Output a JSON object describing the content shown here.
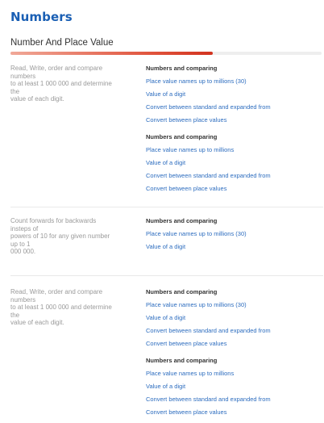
{
  "page": {
    "title": "Numbers",
    "subheading": "Number And Place Value",
    "progress": 0.65
  },
  "sections": [
    {
      "description": "Read, Write, order and compare\nnumbers\nto at least 1 000 000 and determine\nthe\nvalue of each digit.",
      "groups": [
        {
          "title": "Numbers and comparing",
          "links": [
            "Place value names up to millions (30)",
            "Value of a digit",
            "Convert between standard and expanded from",
            "Convert between place values"
          ]
        },
        {
          "title": "Numbers and comparing",
          "links": [
            "Place value names up to millions",
            "Value of a digit",
            "Convert between standard and expanded from",
            "Convert between place values"
          ]
        }
      ]
    },
    {
      "description": "Count forwards for backwards\ninsteps of\npowers of 10 for any given number\nup to 1\n000 000.",
      "groups": [
        {
          "title": "Numbers and comparing",
          "links": [
            "Place value names up to millions (30)",
            "Value of a digit"
          ]
        }
      ]
    },
    {
      "description": "Read, Write, order and compare\nnumbers\nto at least 1 000 000 and determine\nthe\nvalue of each digit.",
      "groups": [
        {
          "title": "Numbers and comparing",
          "links": [
            "Place value names up to millions (30)",
            "Value of a digit",
            "Convert between standard and expanded from",
            "Convert between place values"
          ]
        },
        {
          "title": "Numbers and comparing",
          "links": [
            "Place value names up to millions",
            "Value of a digit",
            "Convert between standard and expanded from",
            "Convert between place values"
          ]
        }
      ]
    }
  ]
}
